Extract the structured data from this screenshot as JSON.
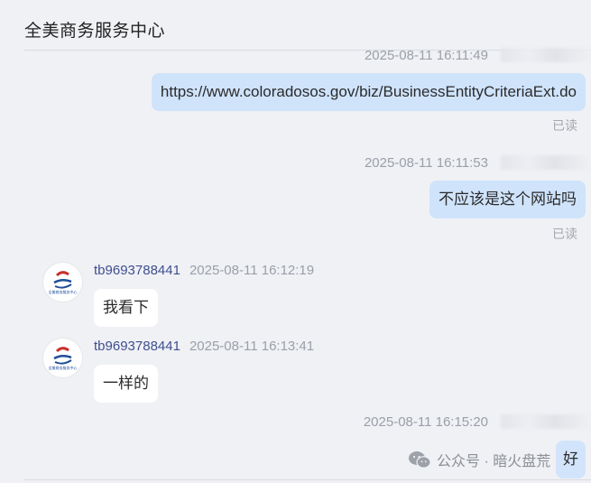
{
  "header": {
    "title": "全美商务服务中心"
  },
  "messages": [
    {
      "direction": "out",
      "time": "2025-08-11 16:11:49",
      "text": "https://www.coloradosos.gov/biz/BusinessEntityCriteriaExt.do",
      "status": "已读"
    },
    {
      "direction": "out",
      "time": "2025-08-11 16:11:53",
      "text": "不应该是这个网站吗",
      "status": "已读"
    },
    {
      "direction": "in",
      "sender": "tb9693788441",
      "time": "2025-08-11 16:12:19",
      "text": "我看下",
      "avatar_text": "全美商务服务中心"
    },
    {
      "direction": "in",
      "sender": "tb9693788441",
      "time": "2025-08-11 16:13:41",
      "text": "一样的",
      "avatar_text": "全美商务服务中心"
    },
    {
      "direction": "out",
      "time": "2025-08-11 16:15:20",
      "text": "好"
    }
  ],
  "watermark": {
    "text": "公众号 · 暗火盘荒",
    "icon": "wechat-icon"
  },
  "colors": {
    "background": "#f0f1f5",
    "outgoing_bubble": "#cfe3fb",
    "incoming_bubble": "#ffffff",
    "sender_name": "#3f4f8f",
    "timestamp": "#9aa0a8"
  }
}
